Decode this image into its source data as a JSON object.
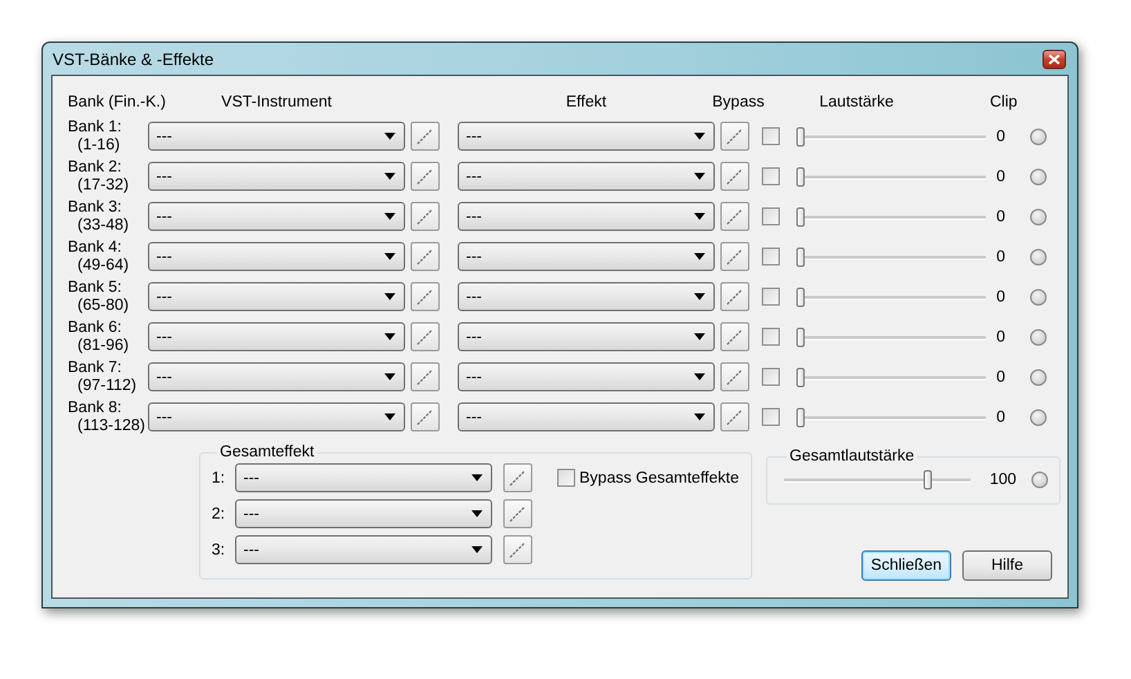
{
  "window": {
    "title": "VST-Bänke & -Effekte"
  },
  "headers": {
    "bank": "Bank (Fin.-K.)",
    "instrument": "VST-Instrument",
    "effect": "Effekt",
    "bypass": "Bypass",
    "volume": "Lautstärke",
    "clip": "Clip"
  },
  "banks": [
    {
      "name": "Bank 1:",
      "range": "(1-16)",
      "instrument": "---",
      "effect": "---",
      "bypass": false,
      "level": 0,
      "reading": "0"
    },
    {
      "name": "Bank 2:",
      "range": "(17-32)",
      "instrument": "---",
      "effect": "---",
      "bypass": false,
      "level": 0,
      "reading": "0"
    },
    {
      "name": "Bank 3:",
      "range": "(33-48)",
      "instrument": "---",
      "effect": "---",
      "bypass": false,
      "level": 0,
      "reading": "0"
    },
    {
      "name": "Bank 4:",
      "range": "(49-64)",
      "instrument": "---",
      "effect": "---",
      "bypass": false,
      "level": 0,
      "reading": "0"
    },
    {
      "name": "Bank 5:",
      "range": "(65-80)",
      "instrument": "---",
      "effect": "---",
      "bypass": false,
      "level": 0,
      "reading": "0"
    },
    {
      "name": "Bank 6:",
      "range": "(81-96)",
      "instrument": "---",
      "effect": "---",
      "bypass": false,
      "level": 0,
      "reading": "0"
    },
    {
      "name": "Bank 7:",
      "range": "(97-112)",
      "instrument": "---",
      "effect": "---",
      "bypass": false,
      "level": 0,
      "reading": "0"
    },
    {
      "name": "Bank 8:",
      "range": "(113-128)",
      "instrument": "---",
      "effect": "---",
      "bypass": false,
      "level": 0,
      "reading": "0"
    }
  ],
  "master_effect": {
    "title": "Gesamteffekt",
    "slots": [
      {
        "label": "1:",
        "value": "---"
      },
      {
        "label": "2:",
        "value": "---"
      },
      {
        "label": "3:",
        "value": "---"
      }
    ],
    "bypass": {
      "label": "Bypass Gesamteffekte",
      "checked": false
    }
  },
  "master_volume": {
    "title": "Gesamtlautstärke",
    "level": 0.79,
    "reading": "100"
  },
  "buttons": [
    {
      "label": "Schließen",
      "default": true
    },
    {
      "label": "Hilfe",
      "default": false
    }
  ]
}
